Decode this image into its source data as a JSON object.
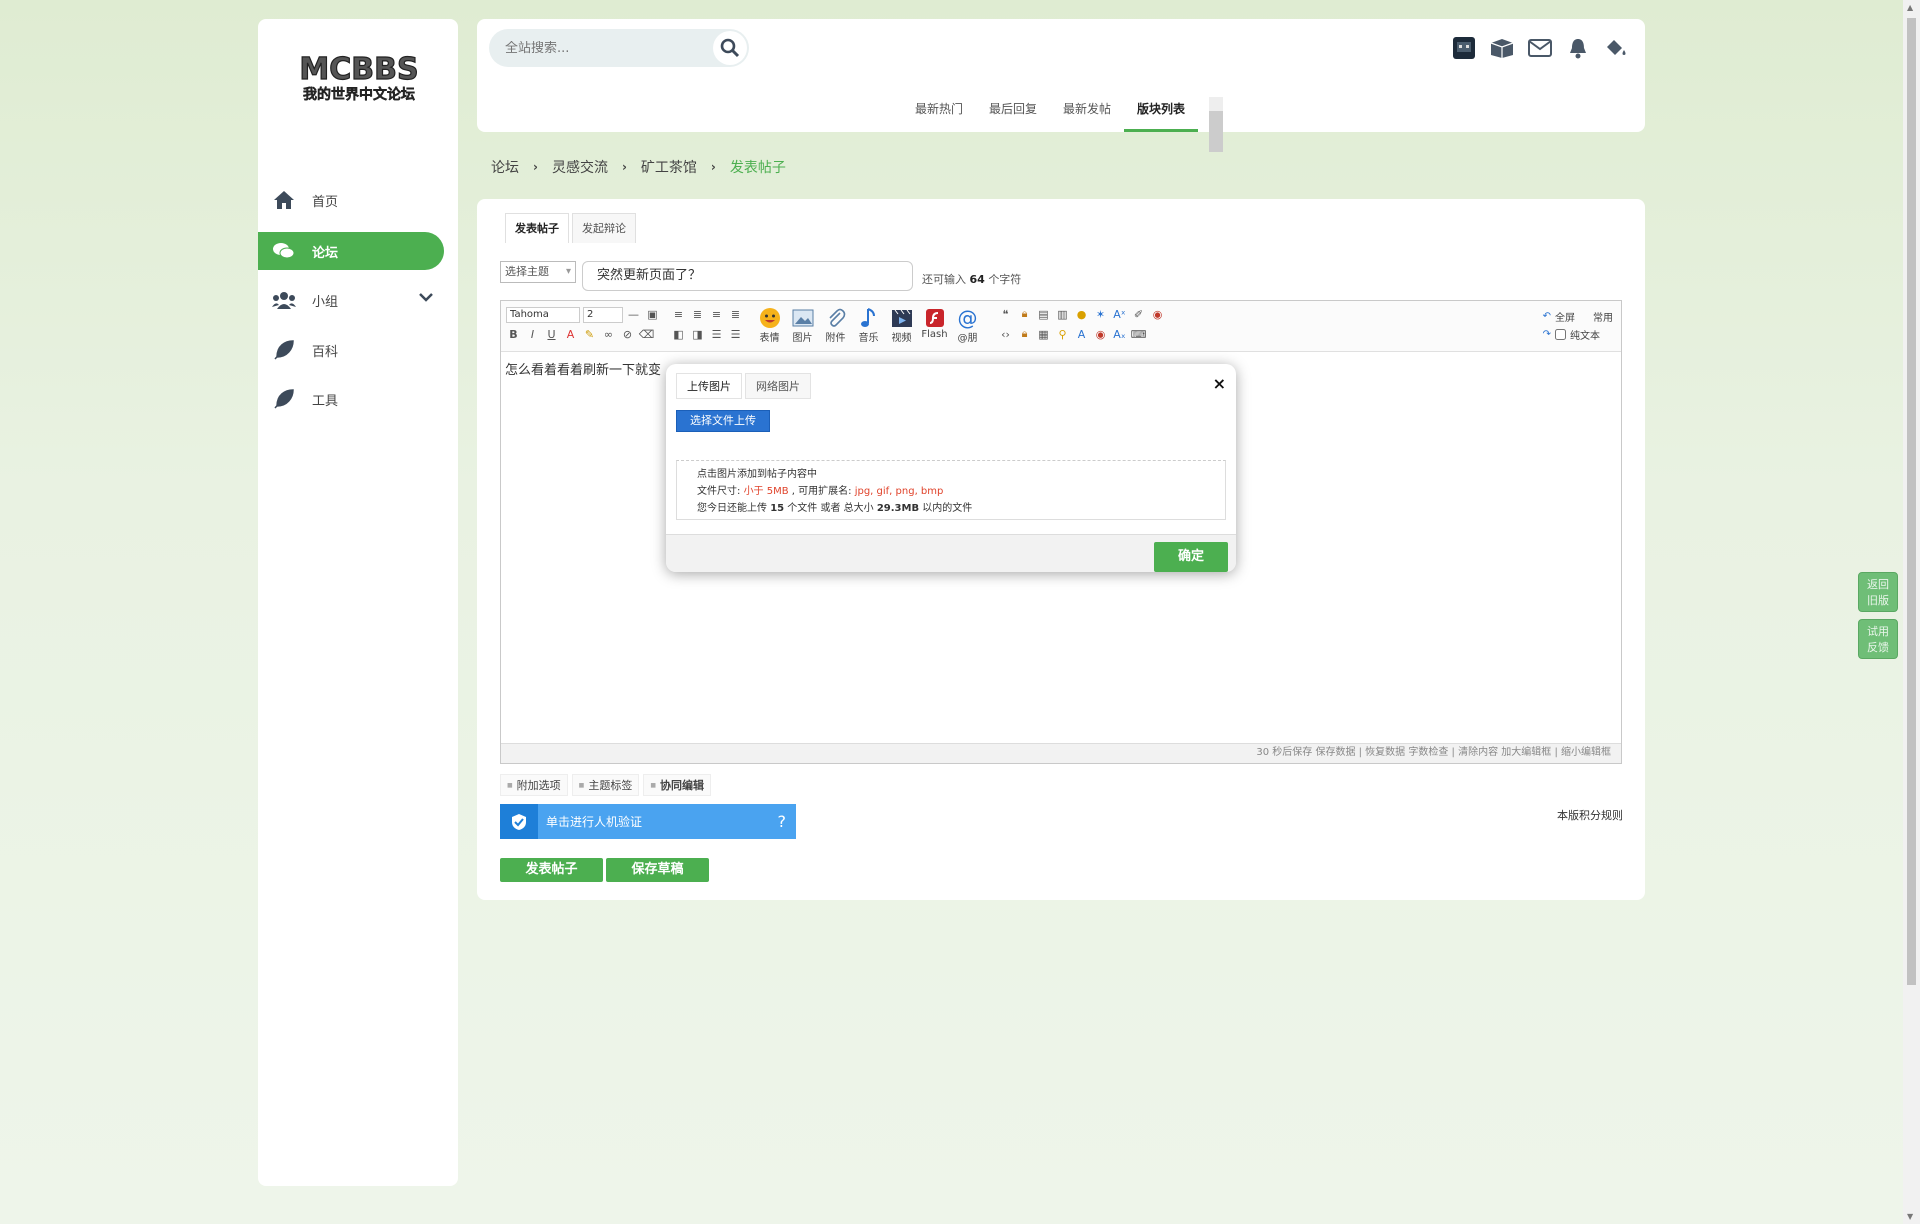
{
  "sidebar": {
    "logo_text": "MCBBS",
    "logo_sub": "我的世界中文论坛",
    "items": [
      {
        "label": "首页",
        "icon": "home-icon"
      },
      {
        "label": "论坛",
        "icon": "chat-icon"
      },
      {
        "label": "小组",
        "icon": "group-icon"
      },
      {
        "label": "百科",
        "icon": "feather-icon"
      },
      {
        "label": "工具",
        "icon": "feather-icon"
      }
    ]
  },
  "header": {
    "search_placeholder": "全站搜索...",
    "tabs": [
      "最新热门",
      "最后回复",
      "最新发帖",
      "版块列表"
    ],
    "active_tab": "版块列表"
  },
  "breadcrumb": [
    "论坛",
    "灵感交流",
    "矿工茶馆",
    "发表帖子"
  ],
  "post": {
    "tabs": [
      "发表帖子",
      "发起辩论"
    ],
    "topic_select": "选择主题",
    "title_value": "突然更新页面了？",
    "char_hint_prefix": "还可输入",
    "char_hint_count": "64",
    "char_hint_suffix": "个字符"
  },
  "editor": {
    "font": "Tahoma",
    "size": "2",
    "big_buttons": [
      "表情",
      "图片",
      "附件",
      "音乐",
      "视频",
      "Flash",
      "@朋"
    ],
    "right": {
      "fullscreen": "全屏",
      "common": "常用",
      "plain_text": "纯文本"
    },
    "body_text": "怎么看着看着刷新一下就变",
    "footer": "30 秒后保存 保存数据 | 恢复数据    字数检查 | 清除内容    加大编辑框 | 缩小编辑框"
  },
  "options": {
    "tabs": [
      "附加选项",
      "主题标签",
      "协同编辑"
    ],
    "captcha": "单击进行人机验证",
    "captcha_q": "?",
    "rules": "本版积分规则",
    "submit": "发表帖子",
    "draft": "保存草稿"
  },
  "dialog": {
    "tabs": [
      "上传图片",
      "网络图片"
    ],
    "close": "×",
    "upload_btn": "选择文件上传",
    "info_line1": "点击图片添加到帖子内容中",
    "info_line2_prefix": "文件尺寸:",
    "info_size": "小于 5MB",
    "info_line2_mid": ", 可用扩展名:",
    "info_exts": "jpg, gif, png, bmp",
    "info_line3_a": "您今日还能上传",
    "info_count": "15",
    "info_line3_b": "个文件 或者 总大小",
    "info_total": "29.3MB",
    "info_line3_c": "以内的文件",
    "ok": "确定"
  },
  "float": {
    "back": "返回\n旧版",
    "feedback": "试用\n反馈"
  },
  "colors": {
    "accent": "#4caf50",
    "captcha": "#4aa3f0",
    "upload": "#2a73d1",
    "warn": "#e0432b"
  }
}
